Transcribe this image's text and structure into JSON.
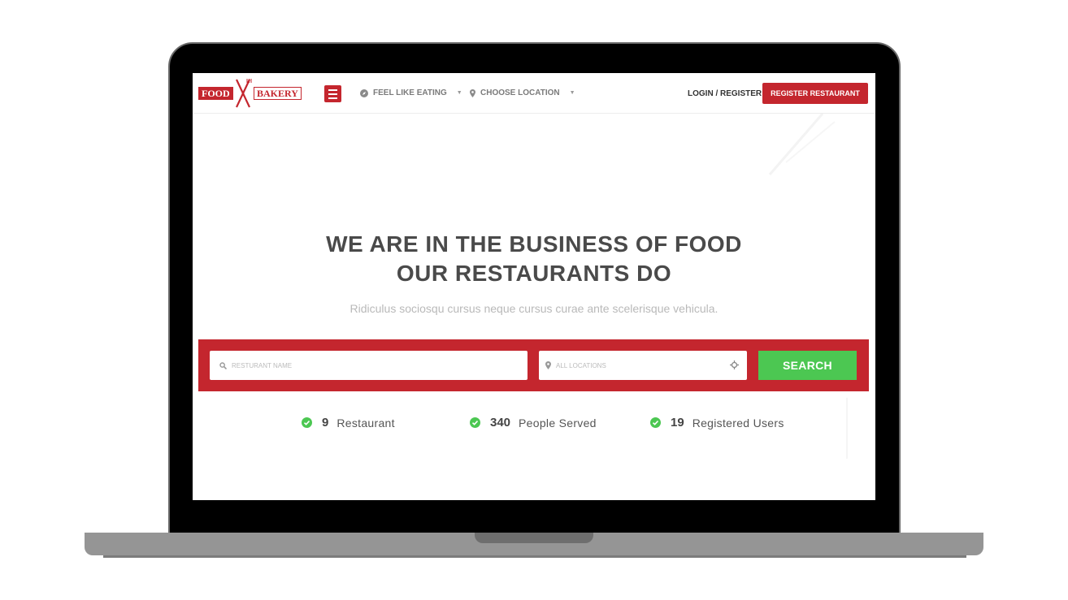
{
  "header": {
    "logo": {
      "left_text": "FOOD",
      "right_text": "BAKERY"
    },
    "menu_icon": "hamburger-icon",
    "nav": [
      {
        "label": "FEEL LIKE EATING",
        "icon": "compass-icon"
      },
      {
        "label": "CHOOSE LOCATION",
        "icon": "map-pin-icon"
      }
    ],
    "login_label": "LOGIN / REGISTER",
    "register_button": "REGISTER RESTAURANT"
  },
  "hero": {
    "title_line1": "WE ARE IN THE BUSINESS OF FOOD",
    "title_line2": "OUR RESTAURANTS DO",
    "subtitle": "Ridiculus sociosqu cursus neque cursus curae ante scelerisque vehicula."
  },
  "search": {
    "name_placeholder": "RESTURANT NAME",
    "location_placeholder": "ALL LOCATIONS",
    "button": "SEARCH"
  },
  "stats": [
    {
      "value": "9",
      "label": "Restaurant"
    },
    {
      "value": "340",
      "label": "People Served"
    },
    {
      "value": "19",
      "label": "Registered Users"
    }
  ],
  "colors": {
    "brand_red": "#c4262e",
    "search_green": "#4cc752",
    "check_green": "#4cc752",
    "title_gray": "#4a4a4a"
  }
}
